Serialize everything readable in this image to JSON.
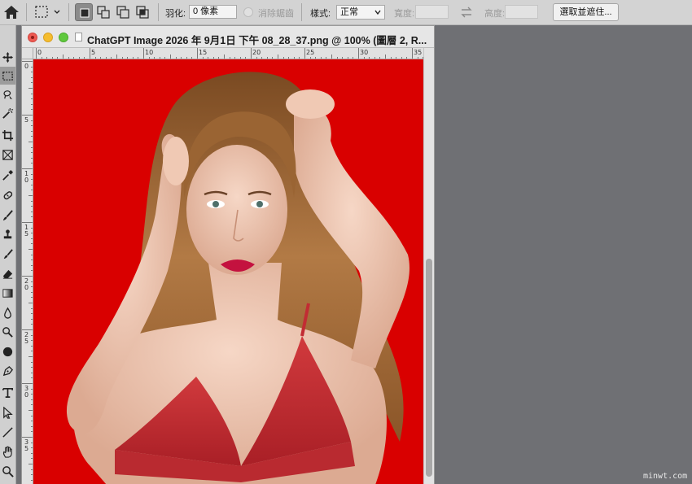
{
  "options_bar": {
    "feather_label": "羽化:",
    "feather_value": "0 像素",
    "antialias_label": "消除鋸齒",
    "style_label": "樣式:",
    "style_value": "正常",
    "width_label": "寬度:",
    "height_label": "高度:",
    "select_mask_button": "選取並遮住..."
  },
  "document": {
    "title": "ChatGPT Image 2026 年 9月1日 下午 08_28_37.png @ 100% (圖層 2, R...",
    "hruler_labels": [
      "0",
      "5",
      "10",
      "15",
      "20",
      "25",
      "30",
      "35"
    ],
    "vruler_labels": [
      "0",
      "5",
      "10",
      "15",
      "20",
      "25",
      "30",
      "35"
    ],
    "canvas_background": "#d90000"
  },
  "toolbar": {
    "tools": [
      "move-icon",
      "rect-marquee-icon",
      "lasso-icon",
      "magic-wand-icon",
      "crop-icon",
      "frame-icon",
      "eyedropper-icon",
      "healing-brush-icon",
      "brush-icon",
      "clone-stamp-icon",
      "history-brush-icon",
      "eraser-icon",
      "gradient-icon",
      "blur-icon",
      "dodge-icon",
      "sponge-icon",
      "pen-icon",
      "type-icon",
      "path-select-icon",
      "line-icon",
      "hand-icon",
      "zoom-icon"
    ]
  },
  "watermark": "minwt.com"
}
